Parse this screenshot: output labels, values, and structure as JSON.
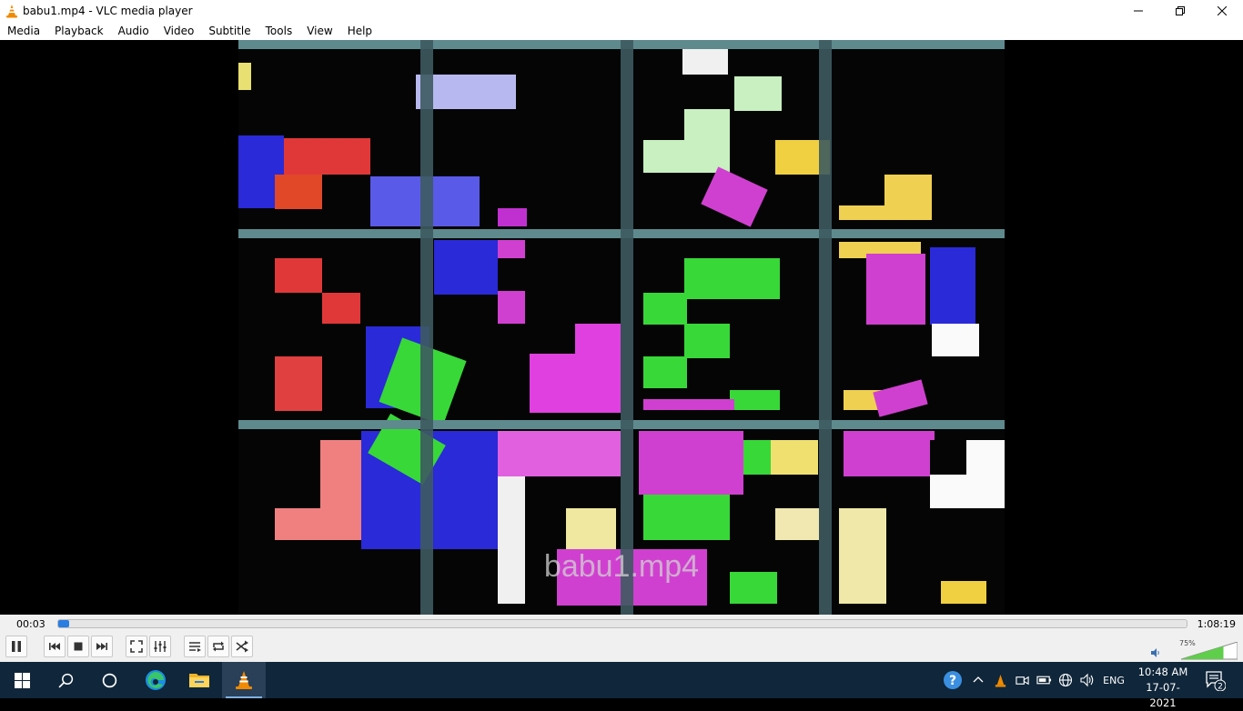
{
  "window": {
    "title": "babu1.mp4 - VLC media player"
  },
  "menu": [
    "Media",
    "Playback",
    "Audio",
    "Video",
    "Subtitle",
    "Tools",
    "View",
    "Help"
  ],
  "video": {
    "overlay_title": "babu1.mp4"
  },
  "seek": {
    "elapsed": "00:03",
    "total": "1:08:19",
    "progress": 0.0007
  },
  "controls": {
    "buttons": [
      "pause-icon",
      "previous-icon",
      "stop-icon",
      "next-icon",
      "fullscreen-icon",
      "extended-settings-icon",
      "playlist-icon",
      "loop-icon",
      "shuffle-icon"
    ],
    "volume_label": "75%",
    "volume": 0.75
  },
  "taskbar": {
    "apps": [
      "windows-start-icon",
      "search-icon",
      "task-view-icon",
      "edge-icon",
      "file-explorer-icon",
      "vlc-icon"
    ],
    "language": "ENG",
    "time": "10:48 AM",
    "date": "17-07-2021",
    "notification_count": "2"
  },
  "colors": {
    "vlc_orange": "#f08a00",
    "seek_fill": "#2a7de1",
    "taskbar_bg": "#10263a",
    "volume_green": "#5fce4a"
  }
}
